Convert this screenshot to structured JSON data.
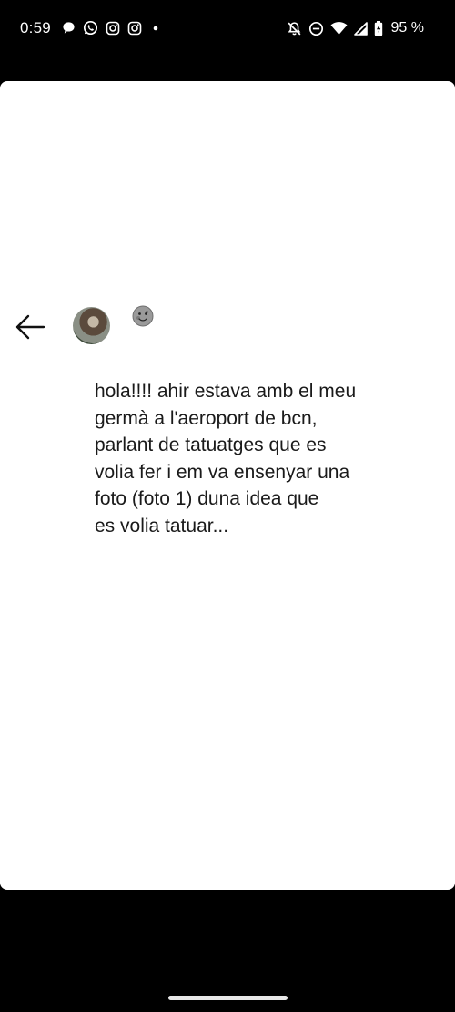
{
  "status_bar": {
    "time": "0:59",
    "notification_icons": [
      "chat-bubble-icon",
      "whatsapp-icon",
      "instagram-icon",
      "instagram-icon",
      "dot-icon"
    ],
    "system_icons": [
      "bell-off-icon",
      "do-not-disturb-icon",
      "wifi-icon",
      "signal-icon",
      "battery-icon"
    ],
    "battery_percent": "95 %"
  },
  "story": {
    "message_lines": [
      "hola!!!! ahir estava amb el meu",
      "germà a l'aeroport de bcn,",
      "parlant de tatuatges que es",
      "volia fer i em va ensenyar una",
      "foto (foto 1) duna idea que",
      "es volia tatuar..."
    ]
  },
  "colors": {
    "background": "#000000",
    "card": "#ffffff",
    "text": "#1a1a1a"
  }
}
